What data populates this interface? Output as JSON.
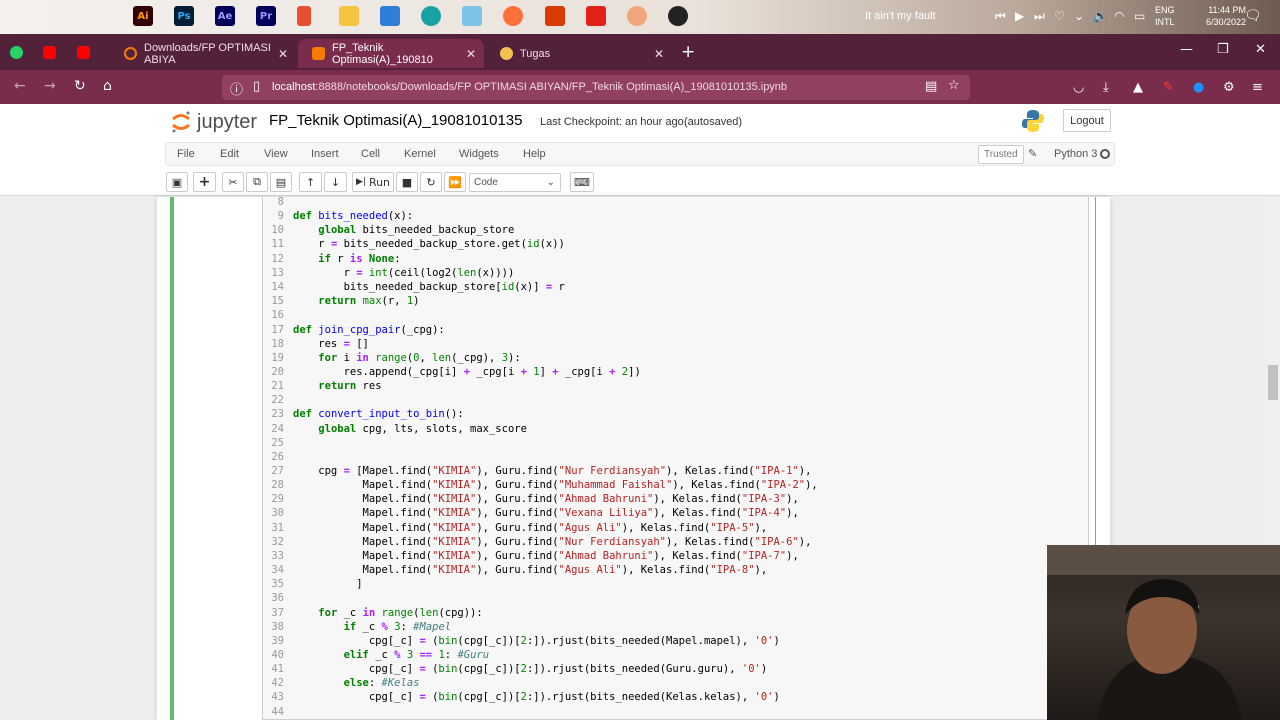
{
  "taskbar": {
    "apps": [
      "Ai",
      "Ps",
      "Ae",
      "Pr",
      "",
      "",
      "",
      "",
      "",
      "",
      "",
      "",
      "",
      "",
      ""
    ],
    "media_title": "It ain't my fault",
    "lang_top": "ENG",
    "lang_bottom": "INTL",
    "time": "11:44 PM",
    "date": "6/30/2022"
  },
  "browser": {
    "tabs": [
      {
        "label": "Downloads/FP OPTIMASI ABIYA"
      },
      {
        "label": "FP_Teknik Optimasi(A)_190810"
      },
      {
        "label": "Tugas"
      }
    ],
    "url_host": "localhost",
    "url_path": ":8888/notebooks/Downloads/FP OPTIMASI ABIYAN/FP_Teknik Optimasi(A)_19081010135.ipynb"
  },
  "jupyter": {
    "logo_text": "jupyter",
    "notebook_title": "FP_Teknik Optimasi(A)_19081010135",
    "checkpoint": "Last Checkpoint: an hour ago",
    "autosaved": "(autosaved)",
    "logout": "Logout",
    "menu": [
      "File",
      "Edit",
      "View",
      "Insert",
      "Cell",
      "Kernel",
      "Widgets",
      "Help"
    ],
    "trusted": "Trusted",
    "kernel": "Python 3",
    "run_label": "Run",
    "cell_type": "Code"
  },
  "code": {
    "line_numbers": [
      "8",
      "9",
      "10",
      "11",
      "12",
      "13",
      "14",
      "15",
      "16",
      "17",
      "18",
      "19",
      "20",
      "21",
      "22",
      "23",
      "24",
      "25",
      "26",
      "27",
      "28",
      "29",
      "30",
      "31",
      "32",
      "33",
      "34",
      "35",
      "36",
      "37",
      "38",
      "39",
      "40",
      "41",
      "42",
      "43",
      "44"
    ]
  },
  "colors": {
    "browser_tab_bg": "#54213a",
    "browser_toolbar_bg": "#7a2c4c",
    "cell_border_selected": "#66bb6a"
  }
}
